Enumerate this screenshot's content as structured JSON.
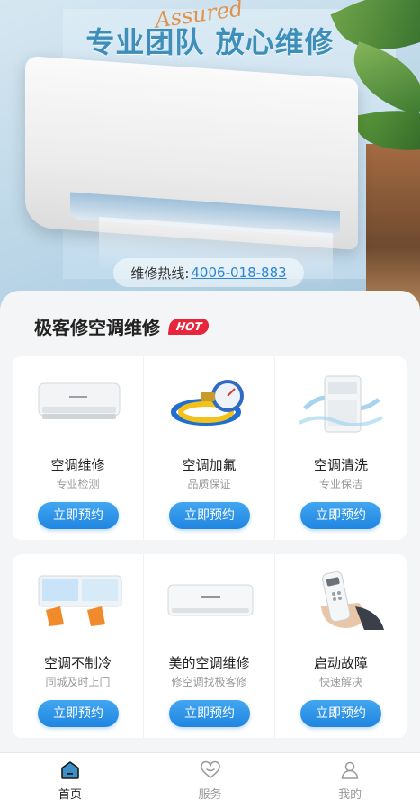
{
  "hero": {
    "script_text": "Assured",
    "title": "专业团队 放心维修",
    "hotline_label": "维修热线:",
    "hotline_number": "4006-018-883"
  },
  "section": {
    "title": "极客修空调维修",
    "badge": "HOT"
  },
  "services": [
    {
      "name": "空调维修",
      "sub": "专业检测",
      "button": "立即预约",
      "icon": "split-ac-icon"
    },
    {
      "name": "空调加氟",
      "sub": "品质保证",
      "button": "立即预约",
      "icon": "refrigerant-gauge-icon"
    },
    {
      "name": "空调清洗",
      "sub": "专业保洁",
      "button": "立即预约",
      "icon": "floor-ac-splash-icon"
    },
    {
      "name": "空调不制冷",
      "sub": "同城及时上门",
      "button": "立即预约",
      "icon": "ac-filter-cleaning-icon"
    },
    {
      "name": "美的空调维修",
      "sub": "修空调找极客修",
      "button": "立即预约",
      "icon": "midea-ac-icon"
    },
    {
      "name": "启动故障",
      "sub": "快速解决",
      "button": "立即预约",
      "icon": "remote-control-icon"
    }
  ],
  "tabbar": [
    {
      "label": "首页",
      "icon": "home-icon",
      "active": true
    },
    {
      "label": "服务",
      "icon": "heart-icon",
      "active": false
    },
    {
      "label": "我的",
      "icon": "user-icon",
      "active": false
    }
  ],
  "colors": {
    "accent": "#1f85e0",
    "hot_badge": "#e8263b",
    "hero_title": "#3d8fb9"
  }
}
